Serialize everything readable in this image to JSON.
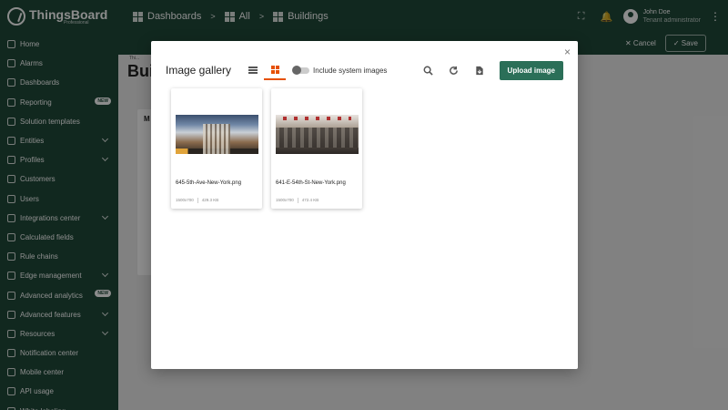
{
  "app": {
    "logo_name": "ThingsBoard",
    "logo_sub": "Professional"
  },
  "breadcrumb": [
    "Dashboards",
    "All",
    "Buildings"
  ],
  "user": {
    "name": "John Doe",
    "role": "Tenant administrator"
  },
  "sidebar": {
    "items": [
      {
        "label": "Home",
        "icon": "home-icon"
      },
      {
        "label": "Alarms",
        "icon": "alarm-icon"
      },
      {
        "label": "Dashboards",
        "icon": "dashboard-icon"
      },
      {
        "label": "Reporting",
        "icon": "report-icon",
        "badge": "NEW"
      },
      {
        "label": "Solution templates",
        "icon": "template-icon"
      },
      {
        "label": "Entities",
        "icon": "entities-icon",
        "chevron": true
      },
      {
        "label": "Profiles",
        "icon": "profiles-icon",
        "chevron": true
      },
      {
        "label": "Customers",
        "icon": "customers-icon"
      },
      {
        "label": "Users",
        "icon": "users-icon"
      },
      {
        "label": "Integrations center",
        "icon": "integrations-icon",
        "chevron": true
      },
      {
        "label": "Calculated fields",
        "icon": "calculated-icon"
      },
      {
        "label": "Rule chains",
        "icon": "rule-chain-icon"
      },
      {
        "label": "Edge management",
        "icon": "edge-icon",
        "chevron": true
      },
      {
        "label": "Advanced analytics",
        "icon": "analytics-icon",
        "badge": "NEW"
      },
      {
        "label": "Advanced features",
        "icon": "features-icon",
        "chevron": true
      },
      {
        "label": "Resources",
        "icon": "resources-icon",
        "chevron": true
      },
      {
        "label": "Notification center",
        "icon": "notification-icon"
      },
      {
        "label": "Mobile center",
        "icon": "mobile-icon"
      },
      {
        "label": "API usage",
        "icon": "api-icon"
      },
      {
        "label": "White labeling",
        "icon": "whitelabel-icon"
      }
    ]
  },
  "dashboard_bar": {
    "cancel_label": "Cancel",
    "save_label": "Save"
  },
  "background": {
    "title": "Bui",
    "card_label": "M",
    "crumb": "Thi..."
  },
  "modal": {
    "title": "Image gallery",
    "include_system_label": "Include system images",
    "upload_label": "Upload image",
    "close_glyph": "×"
  },
  "images": [
    {
      "name": "645-5th-Ave-New-York.png",
      "resolution": "1500x700",
      "size": "429.3 KB"
    },
    {
      "name": "641-E-54th-St-New-York.png",
      "resolution": "1500x700",
      "size": "472.4 KB"
    }
  ],
  "colors": {
    "primary": "#1f4a3a",
    "accent": "#e65100",
    "upload": "#2b6f58"
  }
}
